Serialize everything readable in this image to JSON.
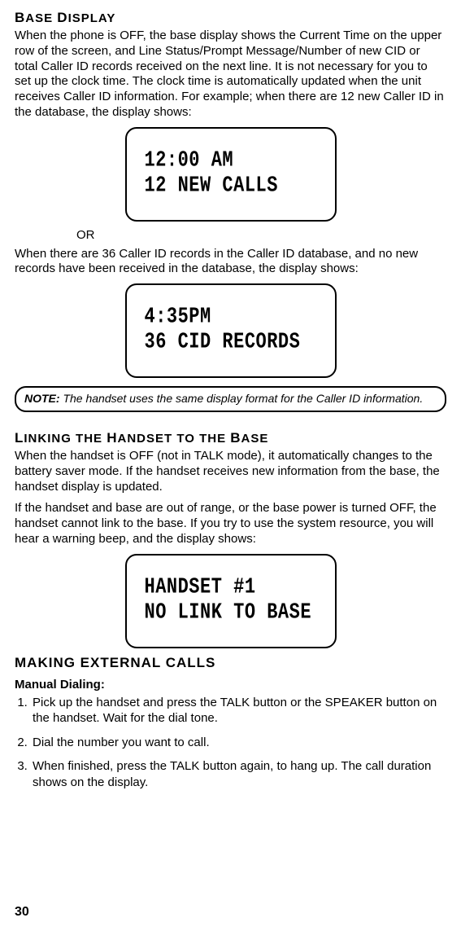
{
  "h1": {
    "cap1": "B",
    "rest1": "ASE ",
    "cap2": "D",
    "rest2": "ISPLAY"
  },
  "p1": "When the phone is OFF, the base display shows the Current Time on the upper row of the screen, and Line Status/Prompt Message/Number of new CID or total Caller ID records received on the next line. It is not necessary for you to set up the clock time. The clock time is automatically updated when the unit receives Caller ID information. For example; when there are 12 new Caller ID in the database, the display shows:",
  "lcd1": {
    "l1": "12:00 AM",
    "l2": "12 NEW CALLS"
  },
  "or": "OR",
  "p2": "When there are 36 Caller ID records in the Caller ID database, and no new records have been received in the database, the display shows:",
  "lcd2": {
    "l1": "4:35PM",
    "l2": "36 CID RECORDS"
  },
  "note": {
    "lead": "NOTE:",
    "text": " The handset uses the same display format for the Caller ID information."
  },
  "h2": {
    "cap1": "L",
    "r1": "INKING THE ",
    "cap2": "H",
    "r2": "ANDSET TO THE ",
    "cap3": "B",
    "r3": "ASE"
  },
  "p3": "When the handset is OFF (not in TALK mode), it automatically changes to the battery saver mode. If the handset receives new information from the base, the handset display is updated.",
  "p4": "If the handset and base are out of range, or the base power is turned OFF, the handset cannot link to the base. If you try to use the system resource, you will hear a warning beep, and the display shows:",
  "lcd3": {
    "l1": "HANDSET #1",
    "l2": "NO LINK TO BASE"
  },
  "h3": {
    "cap1": "M",
    "r1": "AKING ",
    "cap2": "E",
    "r2": "XTERNAL ",
    "cap3": "C",
    "r3": "ALLS"
  },
  "sub": "Manual Dialing:",
  "steps": [
    "Pick up the handset and press the TALK button or the SPEAKER button on the handset. Wait for the dial tone.",
    "Dial the number you want to call.",
    "When finished, press the TALK button again, to hang up. The call duration shows on the display."
  ],
  "page": "30"
}
